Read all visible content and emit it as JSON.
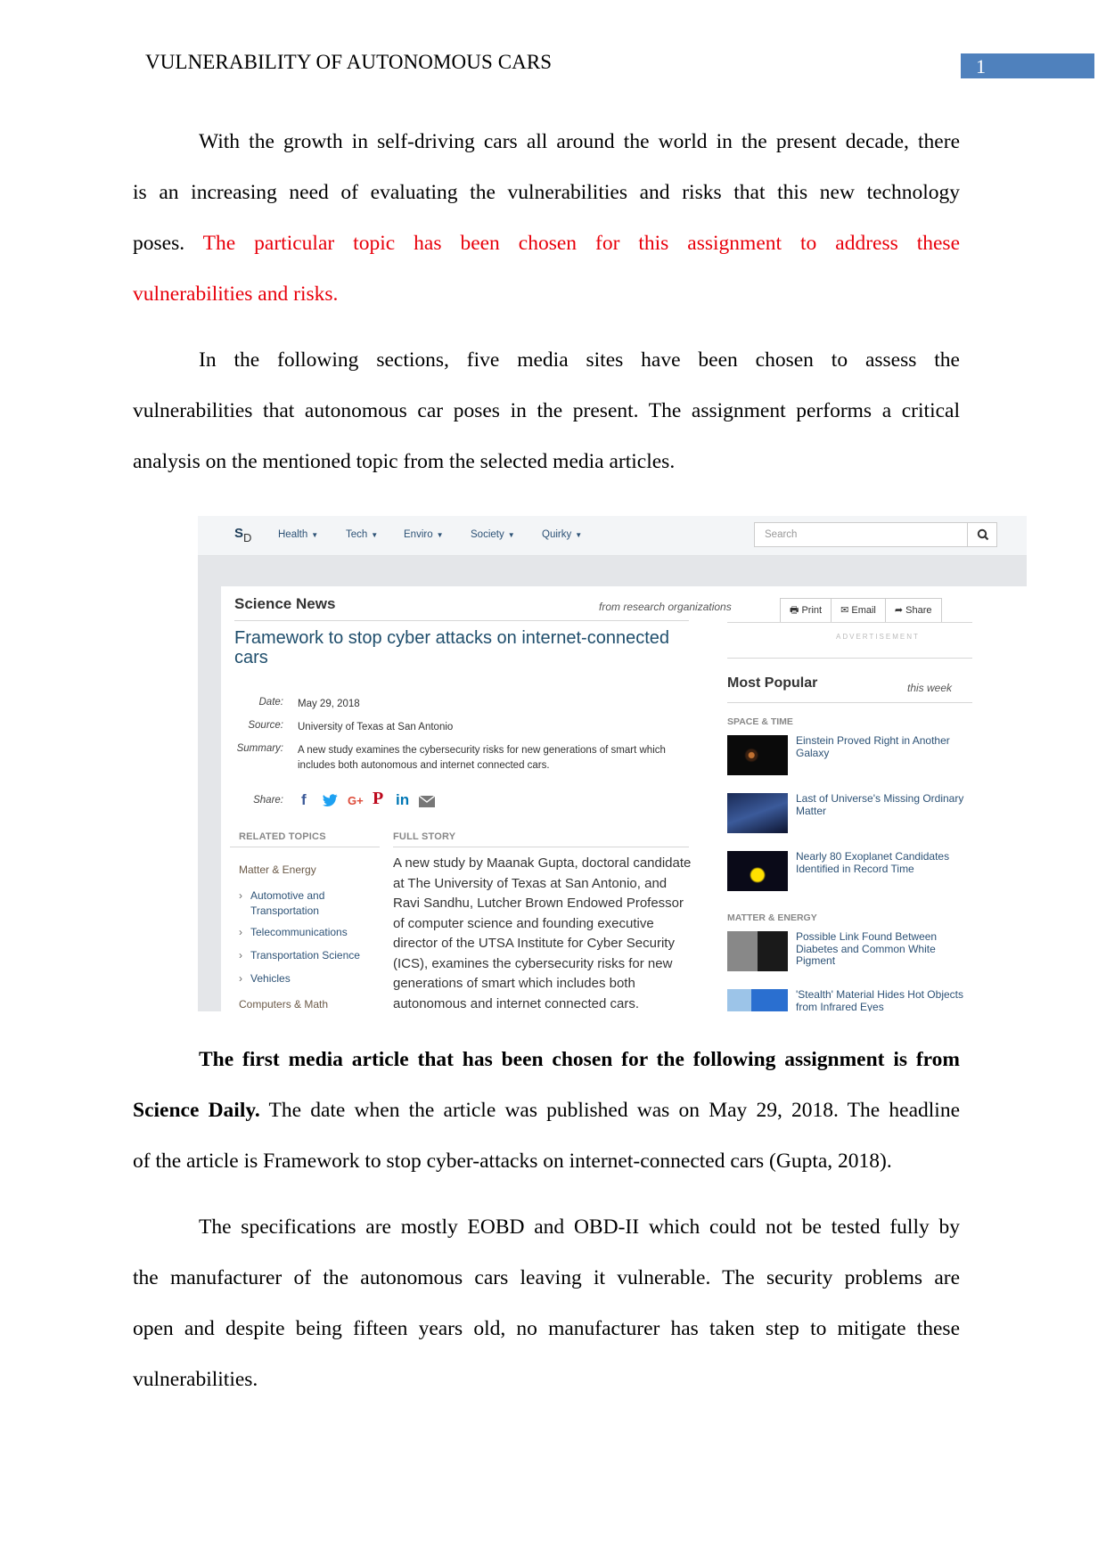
{
  "header": {
    "running_head": "VULNERABILITY OF AUTONOMOUS CARS",
    "page_number": "1",
    "page_number_color": "#4f81bd"
  },
  "paragraph1": {
    "lines": [
      "With the growth in self-driving cars all around the world in the present decade, there",
      "is an increasing need of evaluating the vulnerabilities and risks that this new technology"
    ],
    "line3_black": "poses.",
    "line3_red": "The particular topic has been chosen for this assignment to address these",
    "line4_red": "vulnerabilities and risks.",
    "highlight_color": "#e8000b"
  },
  "paragraph2": {
    "lines": [
      "In the following sections, five media sites have been chosen to assess the",
      "vulnerabilities that autonomous car poses in the present. The assignment performs a critical",
      "analysis on the mentioned topic from the selected media articles."
    ]
  },
  "screenshot": {
    "logo_main": "S",
    "logo_sub": "D",
    "nav": [
      "Health",
      "Tech",
      "Enviro",
      "Society",
      "Quirky"
    ],
    "search_placeholder": "Search",
    "search_icon": "search-icon",
    "section_title": "Science News",
    "section_subtitle": "from research organizations",
    "article_title": "Framework to stop cyber attacks on internet-connected cars",
    "meta": {
      "date_label": "Date:",
      "date": "May 29, 2018",
      "source_label": "Source:",
      "source": "University of Texas at San Antonio",
      "summary_label": "Summary:",
      "summary": "A new study examines the cybersecurity risks for new generations of smart which includes both autonomous and internet connected cars.",
      "share_label": "Share:"
    },
    "share_icons": [
      {
        "name": "facebook-icon",
        "glyph": "f",
        "color": "#3b5998"
      },
      {
        "name": "twitter-icon",
        "glyph": "🐦",
        "color": "#1da1f2"
      },
      {
        "name": "google-plus-icon",
        "glyph": "G+",
        "color": "#dd4b39"
      },
      {
        "name": "pinterest-icon",
        "glyph": "P",
        "color": "#bd081c"
      },
      {
        "name": "linkedin-icon",
        "glyph": "in",
        "color": "#0077b5"
      },
      {
        "name": "email-icon",
        "glyph": "✉",
        "color": "#777777"
      }
    ],
    "related_topics_heading": "RELATED TOPICS",
    "full_story_heading": "FULL STORY",
    "topic_category": "Matter & Energy",
    "topics": [
      "Automotive and Transportation",
      "Telecommunications",
      "Transportation Science",
      "Vehicles"
    ],
    "topic_category_2": "Computers & Math",
    "full_story": "A new study by Maanak Gupta, doctoral candidate at The University of Texas at San Antonio, and Ravi Sandhu, Lutcher Brown Endowed Professor of computer science and founding executive director of the UTSA Institute for Cyber Security (ICS), examines the cybersecurity risks for new generations of smart which includes both autonomous and internet connected cars.",
    "buttons": {
      "print": "Print",
      "email": "Email",
      "share": "Share"
    },
    "advertisement": "ADVERTISEMENT",
    "most_popular": "Most Popular",
    "most_popular_period": "this week",
    "popular_sections": [
      {
        "heading": "SPACE & TIME",
        "items": [
          "Einstein Proved Right in Another Galaxy",
          "Last of Universe's Missing Ordinary Matter",
          "Nearly 80 Exoplanet Candidates Identified in Record Time"
        ]
      },
      {
        "heading": "MATTER & ENERGY",
        "items": [
          "Possible Link Found Between Diabetes and Common White Pigment",
          "'Stealth' Material Hides Hot Objects from Infrared Eyes"
        ]
      }
    ]
  },
  "paragraph3": {
    "line1_bold": "The first media article that has been chosen for the following assignment is from",
    "line2_bold": "Science Daily.",
    "line2_rest": "The date when the article was published was on May 29, 2018. The headline",
    "line3": "of the article is Framework to stop cyber-attacks on internet-connected cars (Gupta, 2018)."
  },
  "paragraph4": {
    "lines": [
      "The specifications are mostly EOBD and OBD-II which could not be tested fully by",
      "the manufacturer of the autonomous cars leaving it vulnerable. The security problems are",
      "open and despite being fifteen years old, no manufacturer has taken step to mitigate these",
      "vulnerabilities."
    ]
  }
}
